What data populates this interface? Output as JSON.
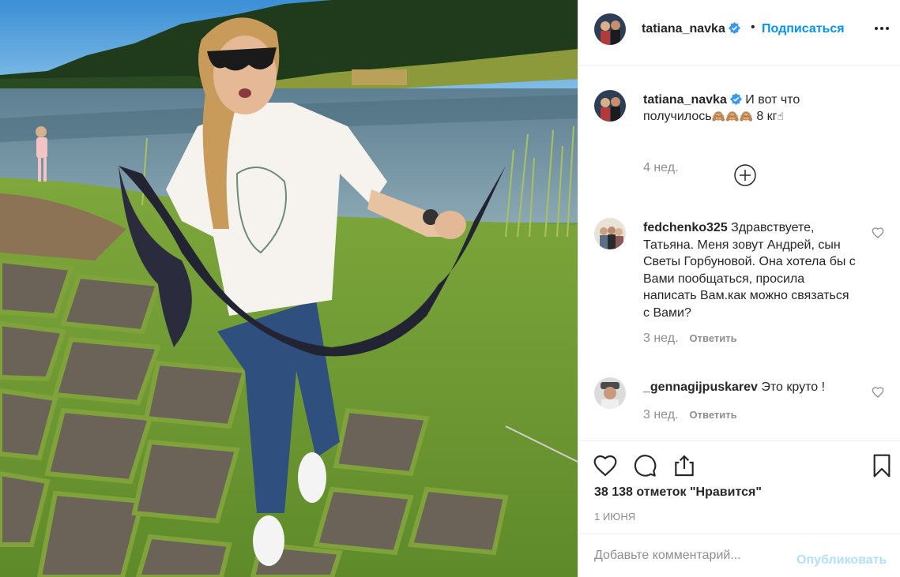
{
  "post": {
    "author": "tatiana_navka",
    "follow_label": "Подписаться",
    "separator": "•"
  },
  "caption": {
    "author": "tatiana_navka",
    "text": "И вот что получилось",
    "emojis": "🙈🙈🙈",
    "suffix": " 8 кг",
    "hand_emoji": "☝",
    "time": "4 нед."
  },
  "comments": [
    {
      "author": "fedchenko325",
      "text": "Здравствуете, Татьяна. Меня зовут Андрей, сын Светы Горбуновой. Она хотела бы с Вами пообщаться, просила написать Вам.как можно связаться с Вами?",
      "time": "3 нед.",
      "reply": "Ответить"
    },
    {
      "author": "_gennagijpuskarev",
      "text": "Это круто !",
      "time": "3 нед.",
      "reply": "Ответить"
    }
  ],
  "stats": {
    "likes": "38 138 отметок \"Нравится\"",
    "date": "1 ИЮНЯ"
  },
  "composer": {
    "placeholder": "Добавьте комментарий...",
    "publish_label": "Опубликовать"
  },
  "colors": {
    "accent": "#0095f6",
    "publish_disabled": "#b2dffc",
    "muted": "#8e8e8e",
    "verified": "#3897f0"
  },
  "icons": {
    "header_more": "more-dots-icon",
    "load_more": "plus-circle-icon",
    "like": "heart-icon",
    "comment": "comment-bubble-icon",
    "share": "share-icon",
    "save": "bookmark-icon",
    "comment_like": "heart-small-icon",
    "verified": "verified-badge-icon"
  }
}
